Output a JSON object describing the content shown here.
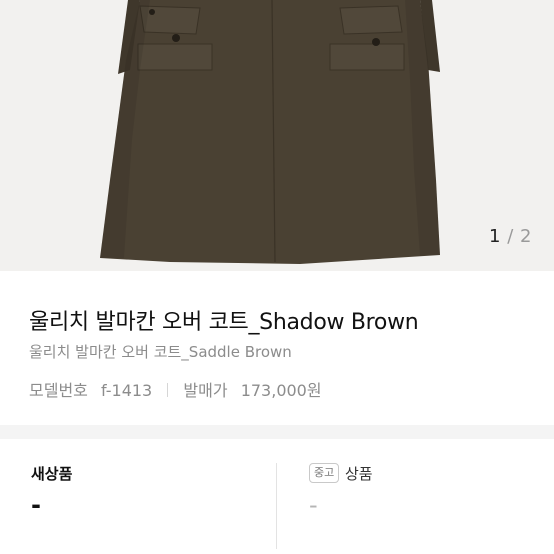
{
  "gallery": {
    "current": "1",
    "separator": "/",
    "total": "2"
  },
  "product": {
    "title": "울리치 발마칸 오버 코트_Shadow Brown",
    "subtitle": "울리치 발마칸 오버 코트_Saddle Brown",
    "model_label": "모델번호",
    "model_value": "f-1413",
    "price_label": "발매가",
    "price_value": "173,000원"
  },
  "tabs": {
    "new_label": "새상품",
    "new_value": "-",
    "used_badge": "중고",
    "used_label": "상품",
    "used_value": "-"
  },
  "colors": {
    "coat": "#4a4133",
    "background": "#f2f1ef"
  }
}
